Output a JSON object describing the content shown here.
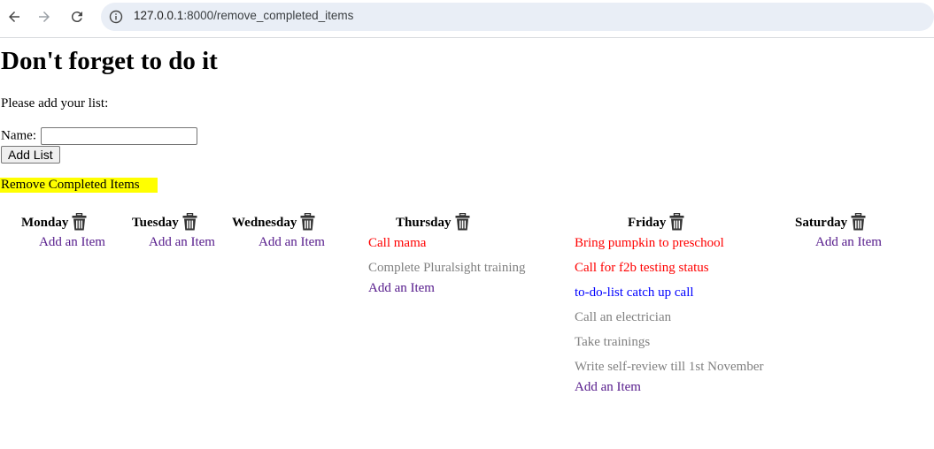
{
  "browser": {
    "url_host": "127.0.0.1",
    "url_rest": ":8000/remove_completed_items"
  },
  "page": {
    "title": "Don't forget to do it",
    "instruction": "Please add your list:",
    "name_label": "Name:",
    "name_value": "",
    "add_list_label": "Add List",
    "remove_completed_label": "Remove Completed Items"
  },
  "days": [
    {
      "name": "Monday",
      "add_item": "Add an Item",
      "items": []
    },
    {
      "name": "Tuesday",
      "add_item": "Add an Item",
      "items": []
    },
    {
      "name": "Wednesday",
      "add_item": "Add an Item",
      "items": []
    },
    {
      "name": "Thursday",
      "add_item": "Add an Item",
      "items": [
        {
          "text": "Call mama",
          "status": "red"
        },
        {
          "text": "Complete Pluralsight training",
          "status": "grey"
        }
      ]
    },
    {
      "name": "Friday",
      "add_item": "Add an Item",
      "items": [
        {
          "text": "Bring pumpkin to preschool",
          "status": "red"
        },
        {
          "text": "Call for f2b testing status",
          "status": "red"
        },
        {
          "text": "to-do-list catch up call",
          "status": "blue"
        },
        {
          "text": "Call an electrician",
          "status": "grey"
        },
        {
          "text": "Take trainings",
          "status": "grey"
        },
        {
          "text": "Write self-review till 1st November",
          "status": "grey"
        }
      ]
    },
    {
      "name": "Saturday",
      "add_item": "Add an Item",
      "items": []
    }
  ],
  "colors": {
    "highlight": "#ffff00",
    "red": "#ff0000",
    "blue": "#0000ff",
    "grey": "#808080",
    "link": "#551a8b"
  },
  "icons": [
    "back-arrow-icon",
    "forward-arrow-icon",
    "reload-icon",
    "info-icon",
    "trash-icon"
  ]
}
